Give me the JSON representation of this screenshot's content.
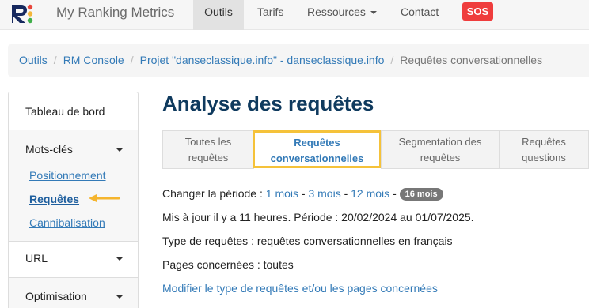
{
  "brand": {
    "name": "My Ranking Metrics",
    "logo_icon": "rm-logo-icon"
  },
  "nav": {
    "items": [
      {
        "label": "Outils",
        "active": true
      },
      {
        "label": "Tarifs"
      },
      {
        "label": "Ressources",
        "dropdown": true
      },
      {
        "label": "Contact"
      }
    ],
    "sos_label": "SOS"
  },
  "breadcrumb": [
    {
      "label": "Outils"
    },
    {
      "label": "RM Console"
    },
    {
      "label": "Projet \"danseclassique.info\" - danseclassique.info"
    },
    {
      "label": "Requêtes conversationnelles",
      "current": true
    }
  ],
  "sidebar": {
    "dashboard": "Tableau de bord",
    "keywords": {
      "label": "Mots-clés",
      "items": [
        {
          "label": "Positionnement"
        },
        {
          "label": "Requêtes",
          "active": true
        },
        {
          "label": "Cannibalisation"
        }
      ]
    },
    "url": "URL",
    "optimisation": "Optimisation"
  },
  "page": {
    "title": "Analyse des requêtes"
  },
  "tabs": [
    {
      "line1": "Toutes les",
      "line2": "requêtes"
    },
    {
      "line1": "Requêtes",
      "line2": "conversationnelles",
      "active": true
    },
    {
      "line1": "Segmentation des",
      "line2": "requêtes"
    },
    {
      "line1": "Requêtes",
      "line2": "questions"
    }
  ],
  "info": {
    "period_label": "Changer la période :",
    "period_options": [
      "1 mois",
      "3 mois",
      "12 mois"
    ],
    "period_separator": "-",
    "period_selected": "16 mois",
    "updated": "Mis à jour il y a 11 heures. Période : 20/02/2024 au 01/07/2025.",
    "query_type": "Type de requêtes : requêtes conversationnelles en français",
    "pages": "Pages concernées : toutes",
    "modify_link": "Modifier le type de requêtes et/ou les pages concernées"
  },
  "colors": {
    "accent": "#337ab7",
    "title": "#0f3a5e",
    "highlight": "#f5c23a",
    "sos": "#ef3d3d"
  }
}
